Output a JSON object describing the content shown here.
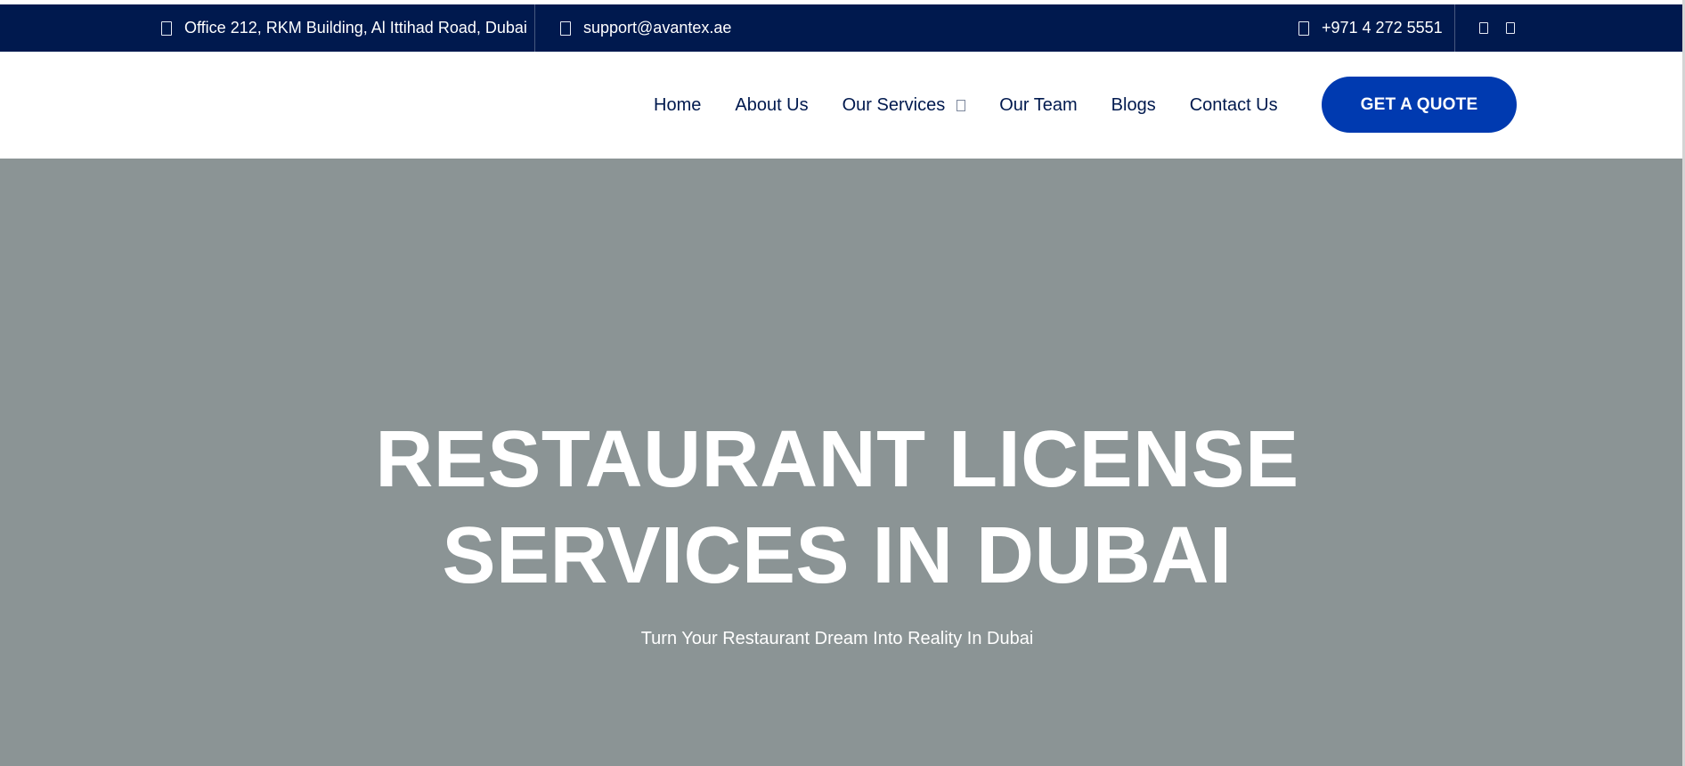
{
  "topbar": {
    "address": "Office 212, RKM Building, Al Ittihad Road, Dubai",
    "email": "support@avantex.ae",
    "phone": "+971 4 272 5551",
    "icons": {
      "address": "location-pin-icon",
      "email": "envelope-icon",
      "phone": "phone-icon",
      "social": [
        "social-icon-1",
        "social-icon-2"
      ]
    }
  },
  "nav": {
    "items": [
      {
        "label": "Home"
      },
      {
        "label": "About Us"
      },
      {
        "label": "Our Services",
        "has_dropdown": true
      },
      {
        "label": "Our Team"
      },
      {
        "label": "Blogs"
      },
      {
        "label": "Contact Us"
      }
    ],
    "cta_label": "GET A QUOTE"
  },
  "hero": {
    "title_line1": "RESTAURANT LICENSE",
    "title_line2": "SERVICES IN DUBAI",
    "subtitle": "Turn Your Restaurant Dream Into Reality In Dubai"
  },
  "colors": {
    "topbar_bg": "#00194e",
    "nav_text": "#00194e",
    "cta_bg": "#003ab0",
    "hero_bg": "#8b9495",
    "hero_text": "#ffffff"
  }
}
